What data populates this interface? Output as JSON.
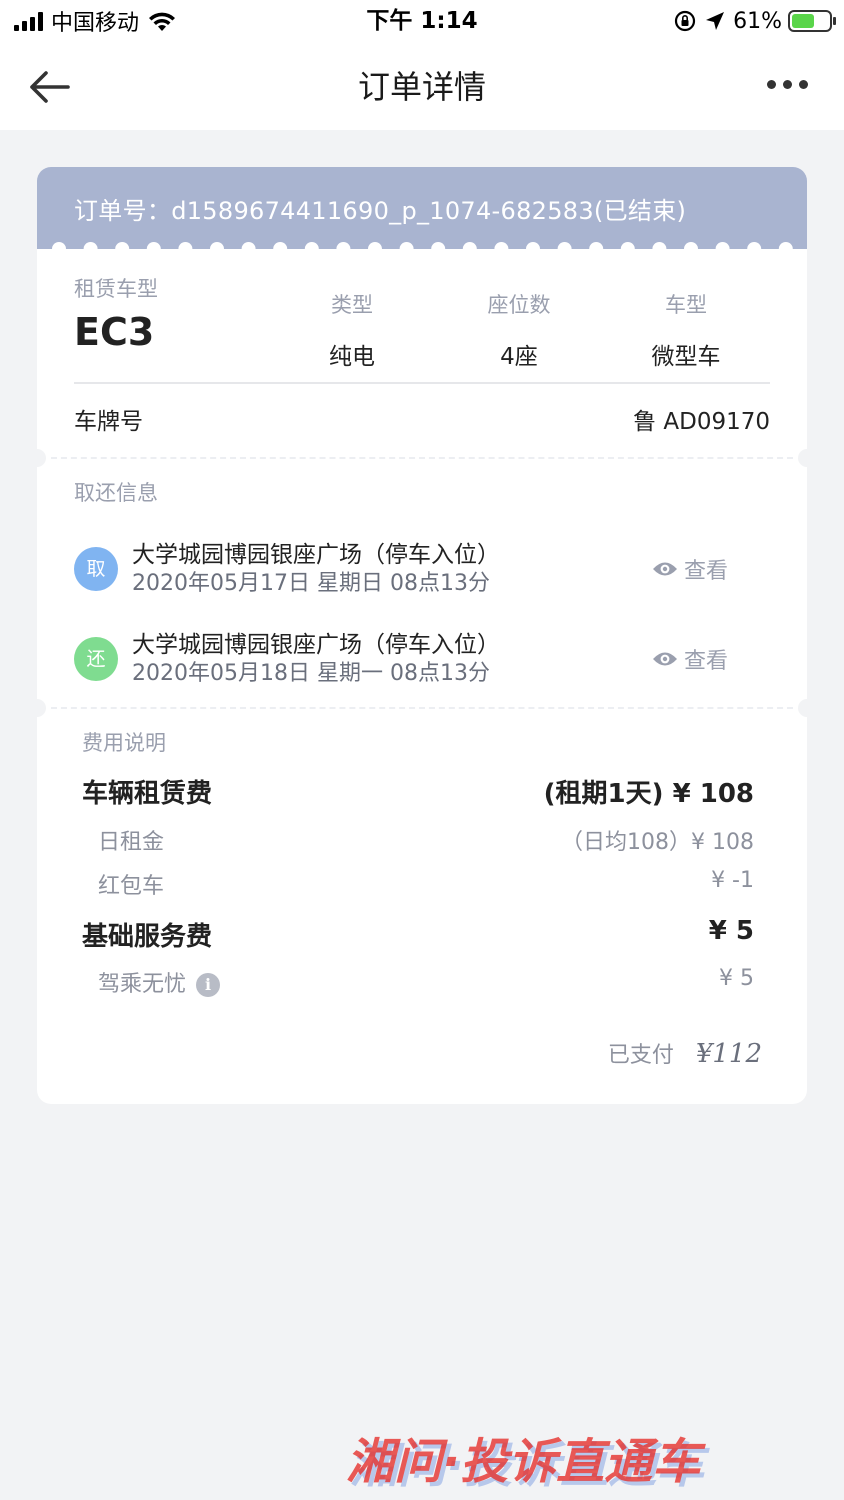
{
  "status_bar": {
    "carrier": "中国移动",
    "time": "下午 1:14",
    "battery": "61%",
    "battery_level": 0.61
  },
  "nav": {
    "title": "订单详情"
  },
  "order": {
    "order_no": "订单号：d1589674411690_p_1074-682583(已结束)"
  },
  "vehicle": {
    "model_label": "租赁车型",
    "model_name": "EC3",
    "specs": [
      {
        "key": "类型",
        "value": "纯电"
      },
      {
        "key": "座位数",
        "value": "4座"
      },
      {
        "key": "车型",
        "value": "微型车"
      }
    ],
    "plate_label": "车牌号",
    "plate_value": "鲁 AD09170"
  },
  "pickup_return": {
    "label": "取还信息",
    "items": [
      {
        "badge": "取",
        "location": "大学城园博园银座广场（停车入位）",
        "time": "2020年05月17日 星期日 08点13分",
        "view": "查看"
      },
      {
        "badge": "还",
        "location": "大学城园博园银座广场（停车入位）",
        "time": "2020年05月18日 星期一 08点13分",
        "view": "查看"
      }
    ]
  },
  "fees": {
    "label": "费用说明",
    "rental_fee": {
      "label": "车辆租赁费",
      "value": "(租期1天) ¥ 108"
    },
    "daily_rent": {
      "label": "日租金",
      "value": "（日均108）¥ 108"
    },
    "red_packet": {
      "label": "红包车",
      "value": "¥ -1"
    },
    "service_fee": {
      "label": "基础服务费",
      "value": "¥ 5"
    },
    "worry_free": {
      "label": "驾乘无忧",
      "value": "¥ 5"
    },
    "paid_label": "已支付",
    "paid_amount": "¥112"
  },
  "watermark": {
    "text": "湘问·投诉直通车"
  },
  "colors": {
    "header_bg": "#a9b4d0",
    "pickup_badge": "#80b4f1",
    "return_badge": "#7fdc90",
    "watermark": "#e6322e"
  }
}
